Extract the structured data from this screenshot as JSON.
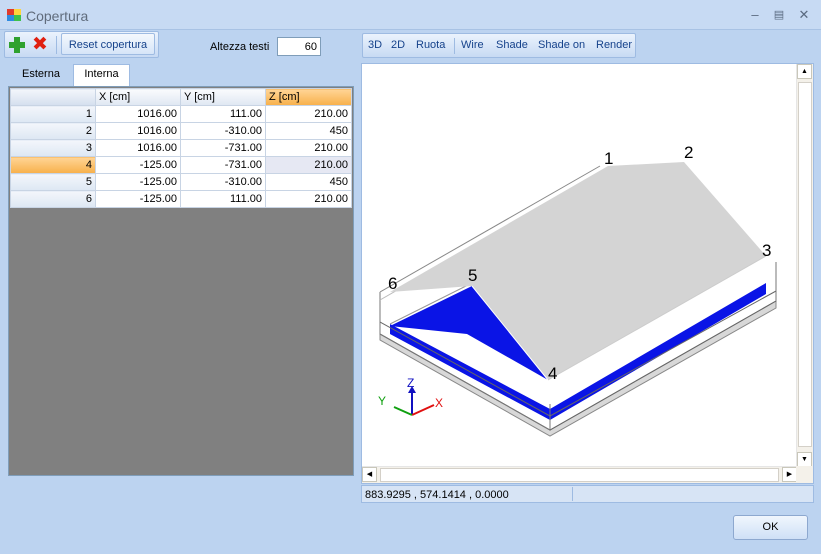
{
  "window": {
    "title": "Copertura"
  },
  "toolbar": {
    "reset_label": "Reset copertura"
  },
  "altezza": {
    "label": "Altezza testi",
    "value": "60"
  },
  "view_toolbar": [
    "3D",
    "2D",
    "Ruota",
    "Wire",
    "Shade",
    "Shade on",
    "Render"
  ],
  "tabs": [
    {
      "label": "Esterna"
    },
    {
      "label": "Interna"
    }
  ],
  "grid": {
    "columns": [
      "X [cm]",
      "Y [cm]",
      "Z [cm]"
    ],
    "rows": [
      {
        "n": "1",
        "x": "1016.00",
        "y": "111.00",
        "z": "210.00"
      },
      {
        "n": "2",
        "x": "1016.00",
        "y": "-310.00",
        "z": "450"
      },
      {
        "n": "3",
        "x": "1016.00",
        "y": "-731.00",
        "z": "210.00"
      },
      {
        "n": "4",
        "x": "-125.00",
        "y": "-731.00",
        "z": "210.00"
      },
      {
        "n": "5",
        "x": "-125.00",
        "y": "-310.00",
        "z": "450"
      },
      {
        "n": "6",
        "x": "-125.00",
        "y": "111.00",
        "z": "210.00"
      }
    ]
  },
  "viewport": {
    "points": [
      "1",
      "2",
      "3",
      "4",
      "5",
      "6"
    ],
    "axes": {
      "x": "X",
      "y": "Y",
      "z": "Z"
    },
    "colors": {
      "base": "#0a14e6",
      "roof": "#d4d4d4",
      "axis_x": "#e01010",
      "axis_y": "#10a010",
      "axis_z": "#1010c0"
    }
  },
  "status": {
    "coords": "883.9295 , 574.1414 , 0.0000"
  },
  "buttons": {
    "ok": "OK"
  }
}
